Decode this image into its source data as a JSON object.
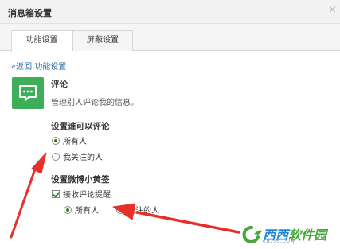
{
  "window": {
    "title": "消息箱设置",
    "close_glyph": "×"
  },
  "tabs": [
    {
      "label": "功能设置",
      "active": true
    },
    {
      "label": "屏蔽设置",
      "active": false
    }
  ],
  "back_link": "«返回 功能设置",
  "feature": {
    "icon": "comment-bubble-icon",
    "icon_color": "#3fae59",
    "name": "评论",
    "description": "管理别人评论我的信息。"
  },
  "who_can_comment": {
    "heading": "设置谁可以评论",
    "options": [
      {
        "label": "所有人",
        "selected": true
      },
      {
        "label": "我关注的人",
        "selected": false
      }
    ]
  },
  "notice": {
    "heading": "设置微博小黄签",
    "checkbox_label": "接收评论提醒",
    "checkbox_checked": true,
    "options": [
      {
        "label": "所有人",
        "selected": true
      },
      {
        "label": "关注的人",
        "selected": false
      }
    ]
  },
  "annotation": {
    "arrow_color": "#e8302a"
  },
  "watermark": {
    "text_part1": "西西",
    "text_part2": "软件园",
    "domain": "CR173.COM"
  }
}
